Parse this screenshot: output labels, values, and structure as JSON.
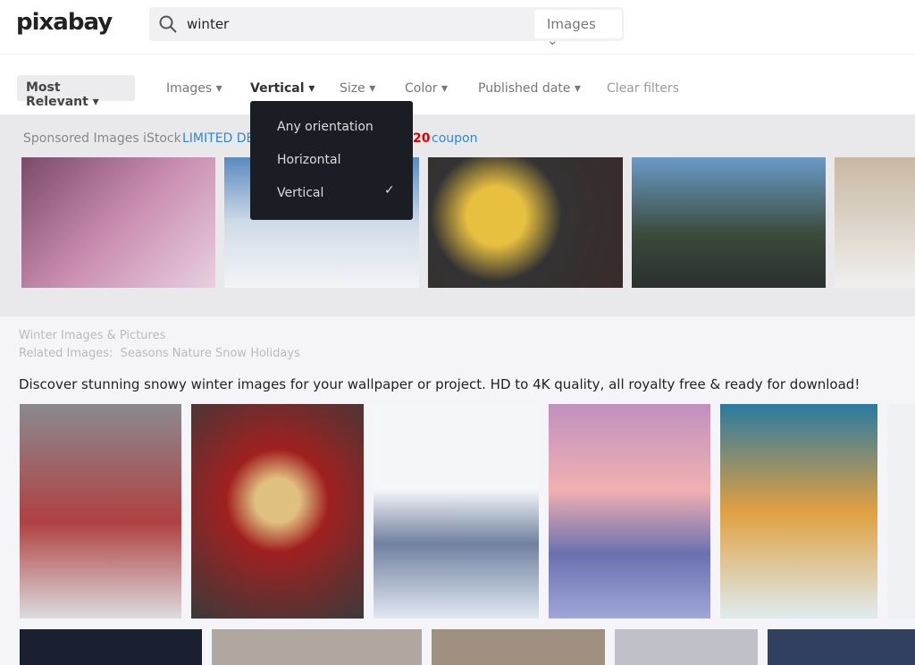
{
  "header": {
    "logo": "pixabay",
    "search_value": "winter",
    "search_type": "Images"
  },
  "filters": {
    "sort": "Most Relevant",
    "items": [
      "Images",
      "Vertical",
      "Size",
      "Color",
      "Published date"
    ],
    "clear": "Clear filters"
  },
  "orientation_menu": {
    "options": [
      "Any orientation",
      "Horizontal",
      "Vertical"
    ],
    "selected": "Vertical",
    "check": "✓"
  },
  "sponsored": {
    "label": "Sponsored Images iStock",
    "promo_start": "LIMITED DE",
    "promo_code": "20",
    "promo_end": "coupon"
  },
  "section": {
    "title": "Winter Images & Pictures",
    "related_label": "Related Images:",
    "related": [
      "Seasons",
      "Nature",
      "Snow",
      "Holidays"
    ],
    "description": "Discover stunning snowy winter images for your wallpaper or project. HD to 4K quality, all royalty free & ready for download!"
  },
  "colors": {
    "accent": "#2b8ad6",
    "promo_red": "#e00000",
    "menu_bg": "#1b1d25"
  }
}
